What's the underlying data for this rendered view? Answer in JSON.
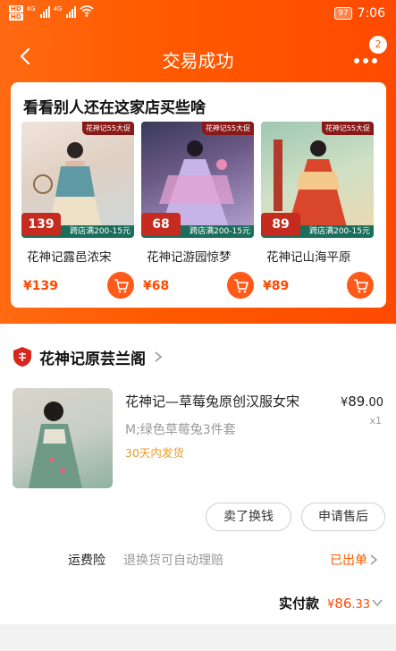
{
  "status_bar": {
    "hd_badges": [
      "HD",
      "HD"
    ],
    "net_labels": [
      "4G",
      "4G"
    ],
    "battery": "97",
    "time": "7:06"
  },
  "nav": {
    "back_icon": "back-arrow-icon",
    "title": "交易成功",
    "more_icon": "more-dots-icon",
    "badge_count": "2"
  },
  "recommend": {
    "title": "看看别人还在这家店买些啥",
    "products": [
      {
        "name": "花神记露邑浓宋",
        "tag": "花神记55大促",
        "badge_price": "139",
        "promo": "跨店满200-15元",
        "price": "¥139",
        "palette": [
          "#e9c9b8",
          "#5f9aa4",
          "#d7e6ea"
        ]
      },
      {
        "name": "花神记游园惊梦",
        "tag": "花神记55大促",
        "badge_price": "68",
        "promo": "跨店满200-15元",
        "price": "¥68",
        "palette": [
          "#3b3a5a",
          "#b6a6d9",
          "#d58cc7"
        ]
      },
      {
        "name": "花神记山海平原",
        "tag": "花神记55大促",
        "badge_price": "89",
        "promo": "跨店满200-15元",
        "price": "¥89",
        "palette": [
          "#8dbfa5",
          "#d94a2a",
          "#f0d0a0"
        ]
      }
    ],
    "cart_icon": "cart-icon"
  },
  "shop": {
    "logo_icon": "shop-badge-icon",
    "name": "花神记原芸兰阁",
    "chevron_icon": "chevron-right-icon"
  },
  "order_item": {
    "title": "花神记—草莓兔原创汉服女宋",
    "price_symbol": "¥",
    "price_int": "89",
    "price_dec": ".00",
    "sku": "M;绿色草莓兔3件套",
    "qty": "x1",
    "ship_note": "30天内发货"
  },
  "actions": {
    "resell": "卖了换钱",
    "after_sale": "申请售后"
  },
  "insurance": {
    "label": "运费险",
    "desc": "退换货可自动理赔",
    "status": "已出单"
  },
  "payment": {
    "label": "实付款",
    "symbol": "¥",
    "amount_int": "86",
    "amount_dec": ".33"
  },
  "colors": {
    "brand_orange": "#ff5a00",
    "price_red": "#ff4a00",
    "ship_note": "#e89a2a"
  }
}
